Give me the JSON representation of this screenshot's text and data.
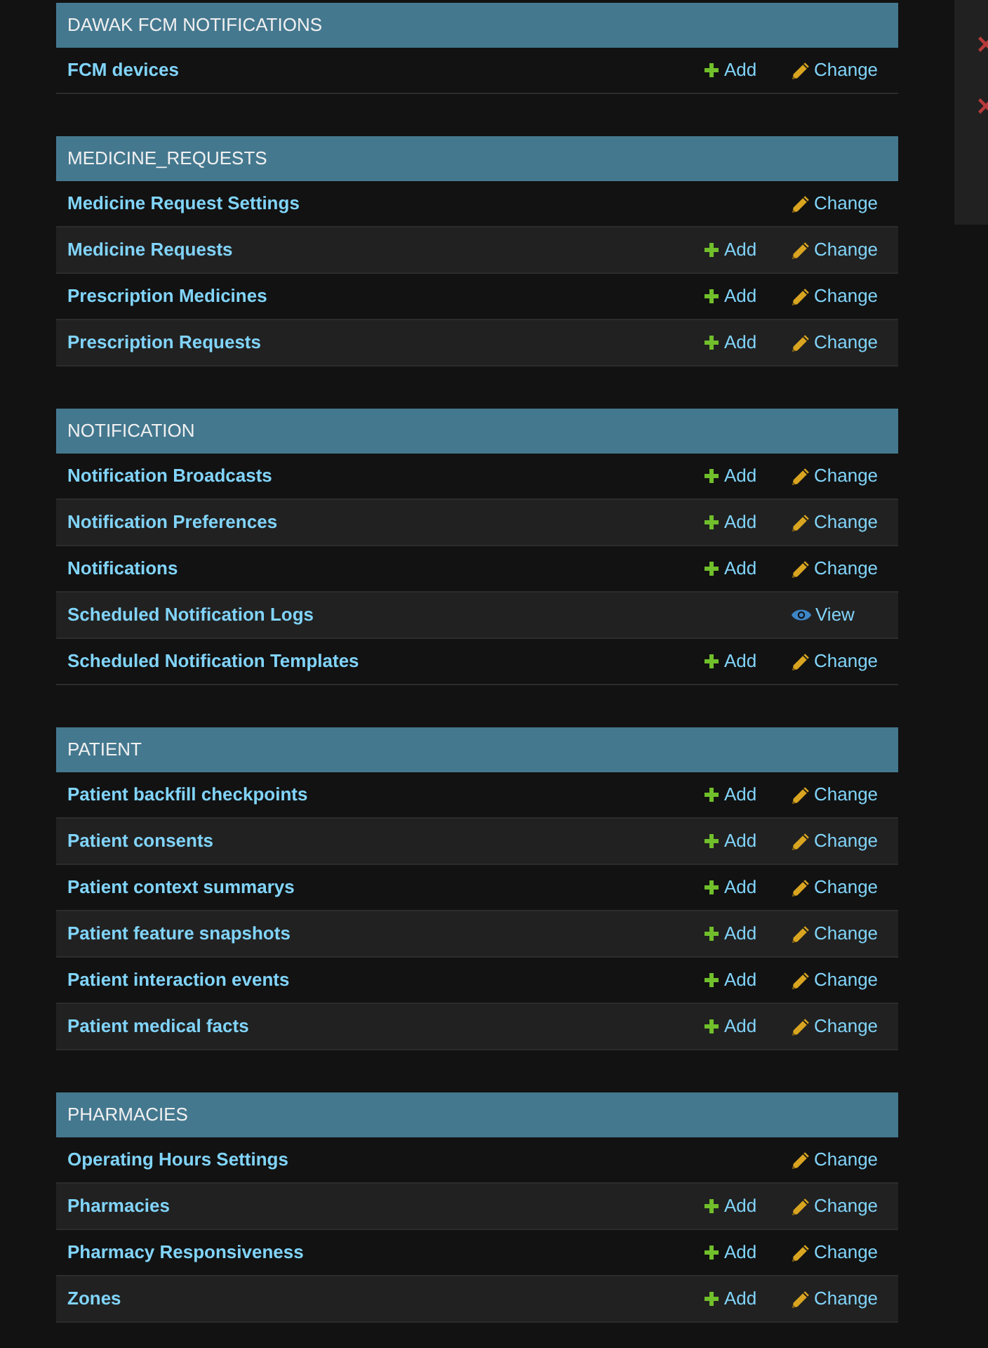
{
  "modules": [
    {
      "caption": "DAWAK FCM NOTIFICATIONS",
      "models": [
        {
          "name": "FCM devices",
          "actions": [
            {
              "kind": "add",
              "label": "Add"
            },
            {
              "kind": "change",
              "label": "Change"
            }
          ]
        }
      ]
    },
    {
      "caption": "MEDICINE_REQUESTS",
      "models": [
        {
          "name": "Medicine Request Settings",
          "actions": [
            {
              "kind": "change",
              "label": "Change"
            }
          ]
        },
        {
          "name": "Medicine Requests",
          "actions": [
            {
              "kind": "add",
              "label": "Add"
            },
            {
              "kind": "change",
              "label": "Change"
            }
          ]
        },
        {
          "name": "Prescription Medicines",
          "actions": [
            {
              "kind": "add",
              "label": "Add"
            },
            {
              "kind": "change",
              "label": "Change"
            }
          ]
        },
        {
          "name": "Prescription Requests",
          "actions": [
            {
              "kind": "add",
              "label": "Add"
            },
            {
              "kind": "change",
              "label": "Change"
            }
          ]
        }
      ]
    },
    {
      "caption": "NOTIFICATION",
      "models": [
        {
          "name": "Notification Broadcasts",
          "actions": [
            {
              "kind": "add",
              "label": "Add"
            },
            {
              "kind": "change",
              "label": "Change"
            }
          ]
        },
        {
          "name": "Notification Preferences",
          "actions": [
            {
              "kind": "add",
              "label": "Add"
            },
            {
              "kind": "change",
              "label": "Change"
            }
          ]
        },
        {
          "name": "Notifications",
          "actions": [
            {
              "kind": "add",
              "label": "Add"
            },
            {
              "kind": "change",
              "label": "Change"
            }
          ]
        },
        {
          "name": "Scheduled Notification Logs",
          "actions": [
            {
              "kind": "view",
              "label": "View"
            }
          ]
        },
        {
          "name": "Scheduled Notification Templates",
          "actions": [
            {
              "kind": "add",
              "label": "Add"
            },
            {
              "kind": "change",
              "label": "Change"
            }
          ]
        }
      ]
    },
    {
      "caption": "PATIENT",
      "models": [
        {
          "name": "Patient backfill checkpoints",
          "actions": [
            {
              "kind": "add",
              "label": "Add"
            },
            {
              "kind": "change",
              "label": "Change"
            }
          ]
        },
        {
          "name": "Patient consents",
          "actions": [
            {
              "kind": "add",
              "label": "Add"
            },
            {
              "kind": "change",
              "label": "Change"
            }
          ]
        },
        {
          "name": "Patient context summarys",
          "actions": [
            {
              "kind": "add",
              "label": "Add"
            },
            {
              "kind": "change",
              "label": "Change"
            }
          ]
        },
        {
          "name": "Patient feature snapshots",
          "actions": [
            {
              "kind": "add",
              "label": "Add"
            },
            {
              "kind": "change",
              "label": "Change"
            }
          ]
        },
        {
          "name": "Patient interaction events",
          "actions": [
            {
              "kind": "add",
              "label": "Add"
            },
            {
              "kind": "change",
              "label": "Change"
            }
          ]
        },
        {
          "name": "Patient medical facts",
          "actions": [
            {
              "kind": "add",
              "label": "Add"
            },
            {
              "kind": "change",
              "label": "Change"
            }
          ]
        }
      ]
    },
    {
      "caption": "PHARMACIES",
      "models": [
        {
          "name": "Operating Hours Settings",
          "actions": [
            {
              "kind": "change",
              "label": "Change"
            }
          ]
        },
        {
          "name": "Pharmacies",
          "actions": [
            {
              "kind": "add",
              "label": "Add"
            },
            {
              "kind": "change",
              "label": "Change"
            }
          ]
        },
        {
          "name": "Pharmacy Responsiveness",
          "actions": [
            {
              "kind": "add",
              "label": "Add"
            },
            {
              "kind": "change",
              "label": "Change"
            }
          ]
        },
        {
          "name": "Zones",
          "actions": [
            {
              "kind": "add",
              "label": "Add"
            },
            {
              "kind": "change",
              "label": "Change"
            }
          ]
        }
      ]
    }
  ],
  "recent_actions": {
    "entries": [
      {
        "kind": "deletion"
      },
      {
        "kind": "deletion"
      }
    ]
  }
}
